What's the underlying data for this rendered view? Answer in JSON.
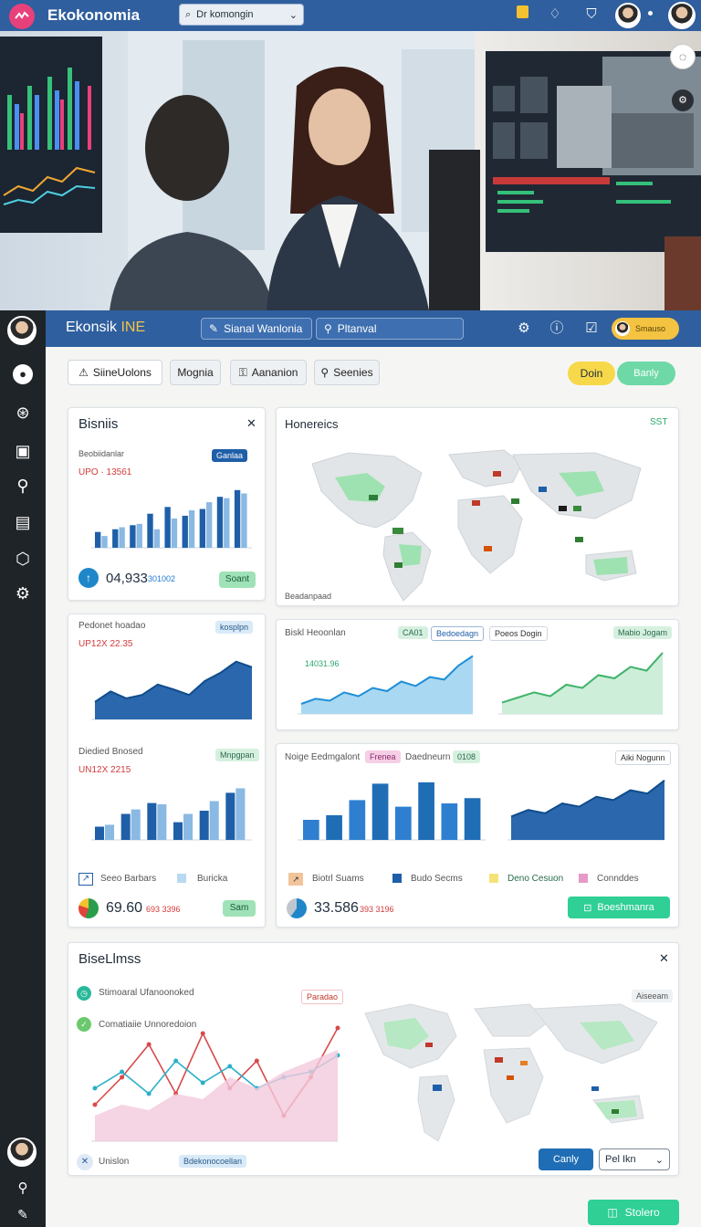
{
  "app": {
    "title": "Ekokonomia",
    "search_text": "Dr komongin"
  },
  "inner": {
    "title_a": "Ekonsik ",
    "title_b": "INE",
    "search1": "Sianal Wanlonia",
    "search2": "Pltanval",
    "user_pill": "Smauso"
  },
  "toolbar": {
    "tabs": [
      "SiineUolons",
      "Mognia",
      "Aananion",
      "Seenies"
    ],
    "btn_yellow": "Doin",
    "btn_green": "Banly"
  },
  "cards": {
    "bisnis": {
      "title": "Bisniis",
      "chart_title": "Beobiidanlar",
      "chart_tag": "Ganlaa",
      "kpi": "UPO · 13561",
      "value": "04,933",
      "value_sub": "301002",
      "button": "Soant"
    },
    "map": {
      "title": "Honereics",
      "badge": "SST",
      "caption": "Beadanpaad"
    },
    "area_small": {
      "title": "Pedonet hoadao",
      "tag": "kosplpn",
      "kpi": "UP12X 22.35"
    },
    "bar_small": {
      "title": "Diedied Bnosed",
      "tag": "Mnpgpan",
      "kpi": "UN12X 2215"
    },
    "left_foot": {
      "legend1": "Seeo Barbars",
      "legend2": "Buricka",
      "value": "69.60",
      "value_sub": "693 3396",
      "button": "Sam"
    },
    "line_panel": {
      "title": "Biskl Heoonlan",
      "tag1": "CA01",
      "tag2": "Bedoedagn",
      "tag3": "Poeos Dogin",
      "tag4": "Mabio Jogam",
      "note": "14031.96"
    },
    "bar_panel": {
      "title": "Noige Eedmgalont",
      "tag1": "Frenea",
      "tag2": "Daedneurn",
      "tag3": "0108",
      "tag4": "Aiki Nogunn"
    },
    "legend_bottom": {
      "l1": "Biotrl Suams",
      "l2": "Budo Secms",
      "l3": "Deno Cesuon",
      "l4": "Connddes"
    },
    "right_foot": {
      "value": "33.586",
      "value_sub": "393 3196",
      "button": "Boeshmanra"
    },
    "bottom": {
      "title": "BiseLlmss",
      "row1": "Stimoaral Ufanoonoked",
      "row2": "Comatiaiie Unnoredoion",
      "tag": "Paradao",
      "tag2": "Aiseeam",
      "foot": "Unislon",
      "foot_tag": "Bdekonocoellan",
      "btn_blue": "Canly",
      "select": "Pel Ikn"
    }
  },
  "footer_button": "Stolero",
  "chart_data": [
    {
      "type": "bar",
      "series": [
        {
          "name": "dark",
          "values": [
            18,
            22,
            28,
            45,
            55,
            42,
            52,
            70,
            80
          ]
        },
        {
          "name": "light",
          "values": [
            12,
            25,
            30,
            22,
            38,
            50,
            62,
            68,
            75
          ]
        }
      ],
      "ylim": [
        0,
        100
      ]
    },
    {
      "type": "area",
      "values": [
        20,
        35,
        25,
        30,
        45,
        38,
        30,
        50,
        62,
        78,
        70
      ],
      "ylim": [
        0,
        100
      ]
    },
    {
      "type": "bar",
      "series": [
        {
          "name": "dark",
          "values": [
            15,
            35,
            52,
            22,
            40,
            68
          ]
        },
        {
          "name": "light",
          "values": [
            18,
            42,
            50,
            35,
            55,
            75
          ]
        }
      ],
      "ylim": [
        0,
        100
      ]
    },
    {
      "type": "area",
      "values": [
        10,
        18,
        15,
        28,
        22,
        35,
        30,
        45,
        38,
        52,
        48,
        70,
        85
      ],
      "ylim": [
        0,
        100
      ]
    },
    {
      "type": "area",
      "values": [
        12,
        20,
        28,
        22,
        40,
        35,
        55,
        50,
        68,
        62,
        90
      ],
      "ylim": [
        0,
        100
      ]
    },
    {
      "type": "bar",
      "values": [
        25,
        32,
        55,
        80,
        45,
        82,
        50,
        58
      ],
      "ylim": [
        0,
        100
      ]
    },
    {
      "type": "area",
      "values": [
        30,
        40,
        35,
        50,
        45,
        60,
        55,
        70,
        65,
        85
      ],
      "ylim": [
        0,
        100
      ]
    },
    {
      "type": "line",
      "series": [
        {
          "name": "red",
          "values": [
            30,
            55,
            85,
            40,
            95,
            45,
            70,
            20,
            55,
            100
          ]
        },
        {
          "name": "teal",
          "values": [
            45,
            60,
            40,
            70,
            50,
            65,
            45,
            55,
            60,
            75
          ]
        },
        {
          "name": "pink",
          "values": [
            20,
            30,
            25,
            40,
            35,
            55,
            45,
            60,
            70,
            80
          ]
        }
      ],
      "ylim": [
        0,
        110
      ]
    }
  ]
}
